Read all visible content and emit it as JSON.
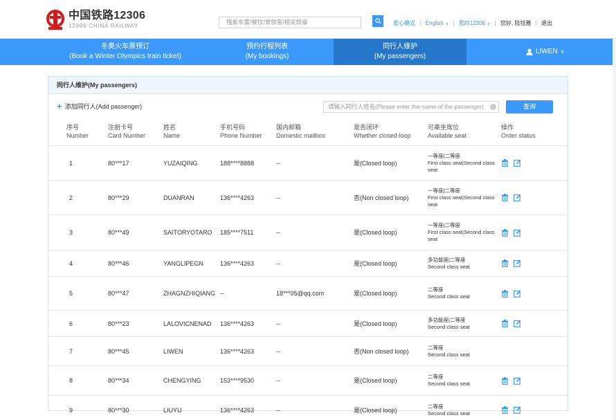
{
  "header": {
    "brand_cn": "中国铁路12306",
    "brand_en": "12306 CHINA RAILWAY",
    "search_placeholder": "搜索车票/餐饮/常旅客/相关规章",
    "links": {
      "care_mode": "爱心模式",
      "english": "English",
      "my12306": "我的12306",
      "greeting": "您好,",
      "user_name": "陆钰雅",
      "logout": "退出"
    }
  },
  "nav": {
    "items": [
      {
        "cn": "冬奥火车票预订",
        "en": "(Book a Winter Olympics train ticket)"
      },
      {
        "cn": "预约行程列表",
        "en": "(My bookings)"
      },
      {
        "cn": "同行人维护",
        "en": "(My passengers)"
      }
    ],
    "user": "LIWEN"
  },
  "panel": {
    "title": "同行人维护(My passengers)",
    "add_label": "添加同行人(Add passenger)",
    "name_placeholder": "请输入同行人姓名(Please enter the name of the passenger)",
    "query_label": "查询"
  },
  "table": {
    "headers": [
      {
        "cn": "序号",
        "en": "Number"
      },
      {
        "cn": "注册卡号",
        "en": "Card Number"
      },
      {
        "cn": "姓名",
        "en": "Name"
      },
      {
        "cn": "手机号码",
        "en": "Phone Number"
      },
      {
        "cn": "国内邮箱",
        "en": "Domestic mailbox"
      },
      {
        "cn": "是否闭环",
        "en": "Whether closed-loop"
      },
      {
        "cn": "可乘坐席位",
        "en": "Available seat"
      },
      {
        "cn": "操作",
        "en": "Order status"
      }
    ],
    "rows": [
      {
        "num": "1",
        "card": "80***17",
        "name": "YUZAIQING",
        "phone": "188****8888",
        "mail": "--",
        "loop": "是(Closed loop)",
        "seat_cn": "一等座|二等座",
        "seat_en": "First class seat|Second class seat",
        "actions": true
      },
      {
        "num": "2",
        "card": "80***29",
        "name": "DUANRAN",
        "phone": "136****4263",
        "mail": "--",
        "loop": "否(Non closed loop)",
        "seat_cn": "一等座|二等座",
        "seat_en": "First class seat|Second class seat",
        "actions": true
      },
      {
        "num": "3",
        "card": "80***49",
        "name": "SAITORYOTARO",
        "phone": "185****7511",
        "mail": "--",
        "loop": "是(Closed loop)",
        "seat_cn": "一等座|二等座",
        "seat_en": "First class seat|Second class seat",
        "actions": true
      },
      {
        "num": "4",
        "card": "80***46",
        "name": "YANGLIPEGN",
        "phone": "136****4263",
        "mail": "--",
        "loop": "是(Closed loop)",
        "seat_cn": "多功能座|二等座",
        "seat_en": "Second class seat",
        "actions": true
      },
      {
        "num": "5",
        "card": "80***47",
        "name": "ZHAGNZHIQIANG",
        "phone": "--",
        "mail": "18***05@qq.com",
        "loop": "是(Closed loop)",
        "seat_cn": "二等座",
        "seat_en": "Second class seat",
        "actions": true
      },
      {
        "num": "6",
        "card": "80***23",
        "name": "LALOVICNENAD",
        "phone": "136****4263",
        "mail": "--",
        "loop": "是(Closed loop)",
        "seat_cn": "多功能座|二等座",
        "seat_en": "Second class seat",
        "actions": true
      },
      {
        "num": "7",
        "card": "80***45",
        "name": "LIWEN",
        "phone": "136****4263",
        "mail": "--",
        "loop": "否(Non closed loop)",
        "seat_cn": "二等座",
        "seat_en": "Second class seat",
        "actions": false
      },
      {
        "num": "8",
        "card": "80***34",
        "name": "CHENGYING",
        "phone": "153****9530",
        "mail": "--",
        "loop": "是(Closed loop)",
        "seat_cn": "二等座",
        "seat_en": "Second class seat",
        "actions": true
      },
      {
        "num": "9",
        "card": "80***30",
        "name": "LIUYU",
        "phone": "136****4263",
        "mail": "--",
        "loop": "是(Closed loop)",
        "seat_cn": "二等座",
        "seat_en": "Second class seat",
        "actions": true
      }
    ]
  },
  "colors": {
    "primary": "#3b99fc",
    "nav_active": "#2677c9",
    "logo_red": "#d7191a",
    "panel_header": "#eef5fd"
  },
  "icons": {
    "search": "search-icon",
    "plus": "plus-icon",
    "user": "user-icon",
    "delete": "trash-icon",
    "edit": "edit-icon",
    "chevron": "chevron-down-icon"
  }
}
